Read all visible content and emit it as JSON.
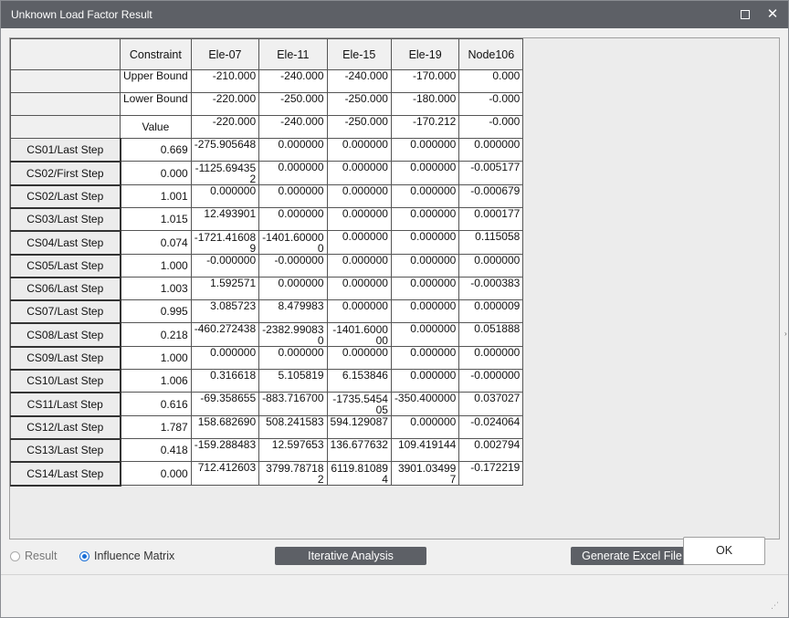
{
  "window": {
    "title": "Unknown Load Factor Result"
  },
  "table": {
    "headers": [
      "Constraint",
      "Ele-07",
      "Ele-11",
      "Ele-15",
      "Ele-19",
      "Node106"
    ],
    "bounds": [
      {
        "label": "Upper Bound",
        "values": [
          "-210.000",
          "-240.000",
          "-240.000",
          "-170.000",
          "0.000"
        ]
      },
      {
        "label": "Lower Bound",
        "values": [
          "-220.000",
          "-250.000",
          "-250.000",
          "-180.000",
          "-0.000"
        ]
      },
      {
        "label": "Value",
        "values": [
          "-220.000",
          "-240.000",
          "-250.000",
          "-170.212",
          "-0.000"
        ]
      }
    ],
    "rows": [
      {
        "name": "CS01/Last Step",
        "factor": "0.669",
        "values": [
          "-275.905648",
          "0.000000",
          "0.000000",
          "0.000000",
          "0.000000"
        ]
      },
      {
        "name": "CS02/First Step",
        "factor": "0.000",
        "values": [
          "-1125.694352",
          "0.000000",
          "0.000000",
          "0.000000",
          "-0.005177"
        ]
      },
      {
        "name": "CS02/Last Step",
        "factor": "1.001",
        "values": [
          "0.000000",
          "0.000000",
          "0.000000",
          "0.000000",
          "-0.000679"
        ]
      },
      {
        "name": "CS03/Last Step",
        "factor": "1.015",
        "values": [
          "12.493901",
          "0.000000",
          "0.000000",
          "0.000000",
          "0.000177"
        ]
      },
      {
        "name": "CS04/Last Step",
        "factor": "0.074",
        "values": [
          "-1721.416089",
          "-1401.600000",
          "0.000000",
          "0.000000",
          "0.115058"
        ]
      },
      {
        "name": "CS05/Last Step",
        "factor": "1.000",
        "values": [
          "-0.000000",
          "-0.000000",
          "0.000000",
          "0.000000",
          "0.000000"
        ]
      },
      {
        "name": "CS06/Last Step",
        "factor": "1.003",
        "values": [
          "1.592571",
          "0.000000",
          "0.000000",
          "0.000000",
          "-0.000383"
        ]
      },
      {
        "name": "CS07/Last Step",
        "factor": "0.995",
        "values": [
          "3.085723",
          "8.479983",
          "0.000000",
          "0.000000",
          "0.000009"
        ]
      },
      {
        "name": "CS08/Last Step",
        "factor": "0.218",
        "values": [
          "-460.272438",
          "-2382.990830",
          "-1401.600000",
          "0.000000",
          "0.051888"
        ]
      },
      {
        "name": "CS09/Last Step",
        "factor": "1.000",
        "values": [
          "0.000000",
          "0.000000",
          "0.000000",
          "0.000000",
          "0.000000"
        ]
      },
      {
        "name": "CS10/Last Step",
        "factor": "1.006",
        "values": [
          "0.316618",
          "5.105819",
          "6.153846",
          "0.000000",
          "-0.000000"
        ]
      },
      {
        "name": "CS11/Last Step",
        "factor": "0.616",
        "values": [
          "-69.358655",
          "-883.716700",
          "-1735.545405",
          "-350.400000",
          "0.037027"
        ]
      },
      {
        "name": "CS12/Last Step",
        "factor": "1.787",
        "values": [
          "158.682690",
          "508.241583",
          "594.129087",
          "0.000000",
          "-0.024064"
        ]
      },
      {
        "name": "CS13/Last Step",
        "factor": "0.418",
        "values": [
          "-159.288483",
          "12.597653",
          "136.677632",
          "109.419144",
          "0.002794"
        ]
      },
      {
        "name": "CS14/Last Step",
        "factor": "0.000",
        "values": [
          "712.412603",
          "3799.787182",
          "6119.810894",
          "3901.034997",
          "-0.172219"
        ]
      }
    ]
  },
  "options": {
    "result_label": "Result",
    "influence_label": "Influence Matrix",
    "selected": "Influence Matrix"
  },
  "buttons": {
    "iterative": "Iterative Analysis",
    "excel": "Generate Excel File",
    "ok": "OK"
  },
  "colors": {
    "titlebar": "#5d6066",
    "radio_accent": "#1a6fd6"
  }
}
